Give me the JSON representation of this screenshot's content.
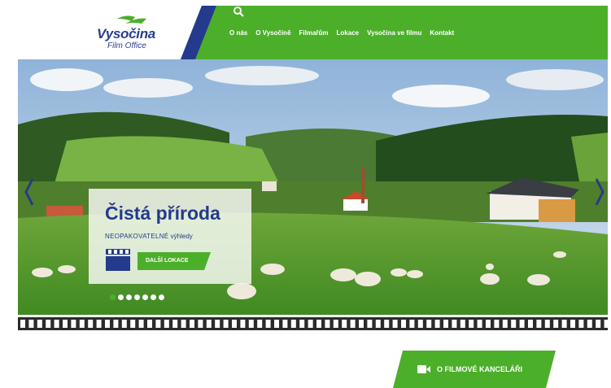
{
  "brand": {
    "name": "Vysočina",
    "subtitle": "Film Office",
    "colors": {
      "green": "#4caf2a",
      "navy": "#243a8c"
    }
  },
  "nav": {
    "items": [
      "O nás",
      "O Vysočině",
      "Filmařům",
      "Lokace",
      "Vysočina ve filmu",
      "Kontakt"
    ],
    "search_icon": "search-icon"
  },
  "hero": {
    "caption_title": "Čistá příroda",
    "caption_sub_strong": "NEOPAKOVATELNÉ",
    "caption_sub_rest": " výhledy",
    "more_button": "DALŠÍ LOKACE",
    "slide_count": 7,
    "active_slide": 0
  },
  "footer_button": {
    "label": "O FILMOVÉ KANCELÁŘI",
    "icon": "video-camera-icon"
  }
}
